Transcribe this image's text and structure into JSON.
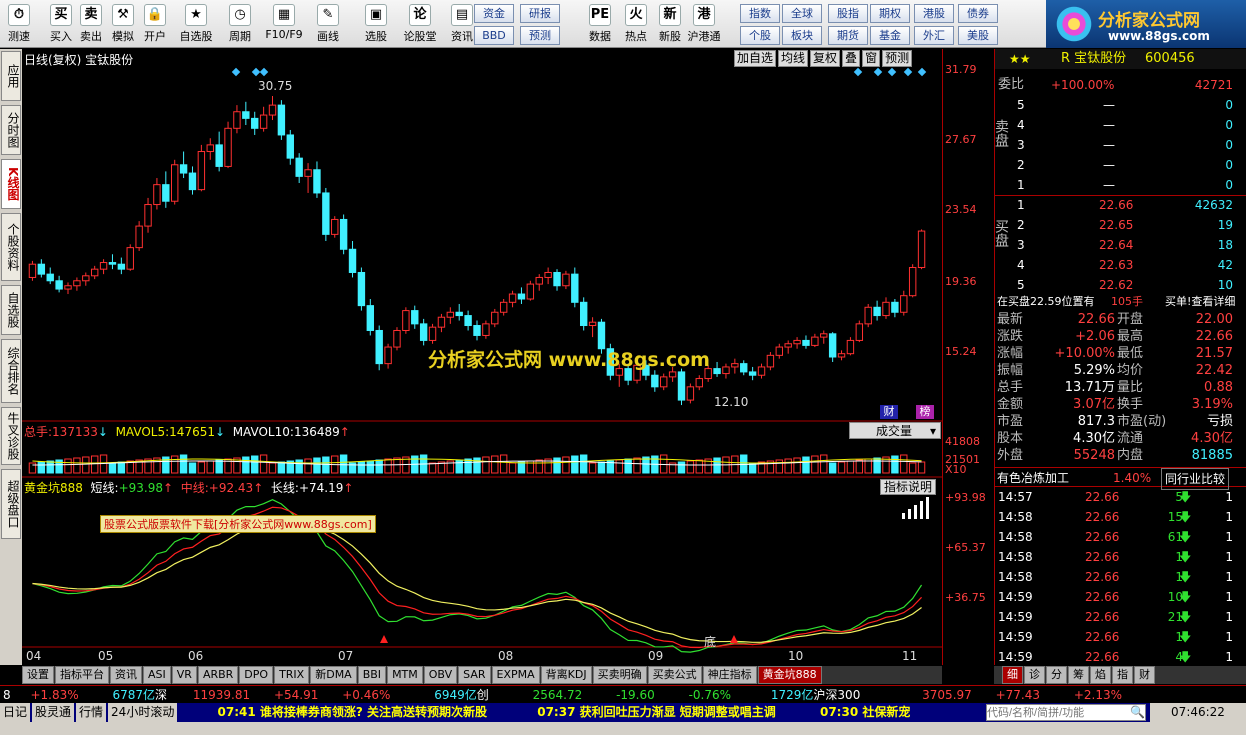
{
  "toolbar": {
    "buttons": [
      {
        "name": "speed-test-button",
        "icon": "clock-icon",
        "glyph": "⏱",
        "label": "测速"
      },
      {
        "name": "buy-button",
        "icon": "buy-icon",
        "glyph": "买",
        "label": "买入"
      },
      {
        "name": "sell-button",
        "icon": "sell-icon",
        "glyph": "卖",
        "label": "卖出"
      },
      {
        "name": "simulate-button",
        "icon": "hammer-icon",
        "glyph": "⚒",
        "label": "模拟"
      },
      {
        "name": "open-account-button",
        "icon": "lock-icon",
        "glyph": "🔒",
        "label": "开户"
      },
      {
        "name": "watchlist-button",
        "icon": "star-icon",
        "glyph": "★",
        "label": "自选股"
      },
      {
        "name": "period-button",
        "icon": "clock-icon",
        "glyph": "◷",
        "label": "周期"
      },
      {
        "name": "f10-button",
        "icon": "grid-icon",
        "glyph": "▦",
        "label": "F10/F9"
      },
      {
        "name": "drawing-button",
        "icon": "pen-icon",
        "glyph": "✎",
        "label": "画线"
      },
      {
        "name": "stock-select-button",
        "icon": "monitor-icon",
        "glyph": "▣",
        "label": "选股"
      },
      {
        "name": "forum-button",
        "icon": "forum-icon",
        "glyph": "论",
        "label": "论股堂"
      },
      {
        "name": "news-button",
        "icon": "document-icon",
        "glyph": "▤",
        "label": "资讯"
      },
      {
        "name": "data-button",
        "icon": "pe-icon",
        "glyph": "PE",
        "label": "数据"
      },
      {
        "name": "hotspot-button",
        "icon": "flame-icon",
        "glyph": "火",
        "label": "热点"
      },
      {
        "name": "new-stock-button",
        "icon": "new-icon",
        "glyph": "新",
        "label": "新股"
      },
      {
        "name": "hk-connect-button",
        "icon": "sh-hk-icon",
        "glyph": "港",
        "label": "沪港通"
      }
    ],
    "square_buttons": [
      [
        "资金",
        "研报"
      ],
      [
        "BBD",
        "预测"
      ],
      [
        "指数",
        "全球"
      ],
      [
        "个股",
        "板块"
      ],
      [
        "股指",
        "期权"
      ],
      [
        "期货",
        "基金"
      ],
      [
        "港股",
        "债券"
      ],
      [
        "外汇",
        "美股"
      ]
    ],
    "logo": {
      "title": "分析家公式网",
      "url": "www.88gs.com"
    }
  },
  "left_tabs": [
    "应用",
    "分时图",
    "K线图",
    "个股资料",
    "自选股",
    "综合排名",
    "牛叉诊股",
    "超级盘口"
  ],
  "chart": {
    "title": "日线(复权) 宝钛股份",
    "controls": [
      "加自选",
      "均线",
      "复权",
      "叠",
      "窗",
      "预测"
    ],
    "price_axis": [
      "31.79",
      "27.67",
      "23.54",
      "19.36",
      "15.24"
    ],
    "high_label": "30.75",
    "low_label": "12.10",
    "watermark": "分析家公式网   www.88gs.com",
    "volume": {
      "total_label": "总手:",
      "total": "137133",
      "mavol5_label": "MAVOL5:",
      "mavol5": "147651",
      "mavol10_label": "MAVOL10:",
      "mavol10": "136489",
      "dropdown": "成交量",
      "axis": [
        "41808",
        "21501",
        "X10"
      ]
    },
    "indicator": {
      "name": "黄金坑888",
      "short_label": "短线:",
      "short": "+93.98",
      "mid_label": "中线:",
      "mid": "+92.43",
      "long_label": "长线:",
      "long": "+74.19",
      "help": "指标说明",
      "axis": [
        "+93.98",
        "+65.37",
        "+36.75"
      ],
      "ad": "股票公式版票软件下载[分析家公式网www.88gs.com]",
      "bottom_label": "底"
    },
    "months": [
      "04",
      "05",
      "06",
      "07",
      "08",
      "09",
      "10",
      "11"
    ],
    "badges": [
      "财",
      "榜"
    ]
  },
  "chart_data": {
    "type": "candlestick",
    "title": "日线(复权) 宝钛股份",
    "y_range": [
      11.5,
      32.5
    ],
    "candles": [
      [
        19.8,
        20.8,
        19.6,
        20.6
      ],
      [
        20.6,
        20.9,
        19.8,
        20.0
      ],
      [
        20.0,
        20.4,
        19.4,
        19.6
      ],
      [
        19.6,
        19.9,
        18.9,
        19.1
      ],
      [
        19.1,
        19.5,
        18.8,
        19.3
      ],
      [
        19.3,
        19.8,
        19.0,
        19.6
      ],
      [
        19.6,
        20.1,
        19.3,
        19.9
      ],
      [
        19.9,
        20.5,
        19.7,
        20.3
      ],
      [
        20.3,
        20.9,
        20.0,
        20.7
      ],
      [
        20.7,
        21.2,
        20.3,
        20.6
      ],
      [
        20.6,
        21.0,
        20.0,
        20.3
      ],
      [
        20.3,
        21.8,
        20.2,
        21.6
      ],
      [
        21.6,
        23.2,
        21.4,
        22.9
      ],
      [
        22.9,
        24.6,
        22.5,
        24.2
      ],
      [
        24.2,
        25.8,
        23.9,
        25.4
      ],
      [
        25.4,
        26.2,
        24.0,
        24.4
      ],
      [
        24.4,
        26.9,
        24.2,
        26.6
      ],
      [
        26.6,
        27.4,
        25.8,
        26.1
      ],
      [
        26.1,
        26.5,
        24.8,
        25.1
      ],
      [
        25.1,
        27.8,
        25.0,
        27.4
      ],
      [
        27.4,
        28.2,
        26.9,
        27.8
      ],
      [
        27.8,
        28.6,
        26.2,
        26.5
      ],
      [
        26.5,
        29.2,
        26.4,
        28.8
      ],
      [
        28.8,
        30.2,
        28.5,
        29.8
      ],
      [
        29.8,
        30.4,
        29.0,
        29.4
      ],
      [
        29.4,
        29.8,
        28.4,
        28.8
      ],
      [
        28.8,
        30.1,
        28.6,
        29.6
      ],
      [
        29.6,
        30.75,
        29.3,
        30.2
      ],
      [
        30.2,
        30.5,
        28.1,
        28.4
      ],
      [
        28.4,
        28.7,
        26.6,
        27.0
      ],
      [
        27.0,
        27.3,
        25.5,
        25.9
      ],
      [
        25.9,
        26.7,
        24.9,
        26.3
      ],
      [
        26.3,
        26.8,
        24.6,
        24.9
      ],
      [
        24.9,
        25.2,
        22.0,
        22.4
      ],
      [
        22.4,
        23.5,
        22.2,
        23.3
      ],
      [
        23.3,
        23.6,
        21.2,
        21.5
      ],
      [
        21.5,
        22.0,
        19.8,
        20.1
      ],
      [
        20.1,
        20.4,
        17.8,
        18.1
      ],
      [
        18.1,
        18.5,
        16.3,
        16.6
      ],
      [
        16.6,
        16.9,
        14.2,
        14.6
      ],
      [
        14.6,
        15.8,
        14.3,
        15.6
      ],
      [
        15.6,
        16.8,
        15.4,
        16.6
      ],
      [
        16.6,
        18.0,
        16.4,
        17.8
      ],
      [
        17.8,
        18.1,
        16.7,
        17.0
      ],
      [
        17.0,
        17.3,
        15.7,
        16.0
      ],
      [
        16.0,
        17.0,
        15.8,
        16.8
      ],
      [
        16.8,
        17.6,
        16.5,
        17.4
      ],
      [
        17.4,
        18.0,
        17.0,
        17.7
      ],
      [
        17.7,
        18.2,
        17.2,
        17.5
      ],
      [
        17.5,
        17.8,
        16.6,
        16.9
      ],
      [
        16.9,
        17.2,
        16.0,
        16.3
      ],
      [
        16.3,
        17.2,
        16.1,
        17.0
      ],
      [
        17.0,
        17.9,
        16.8,
        17.7
      ],
      [
        17.7,
        18.5,
        17.5,
        18.3
      ],
      [
        18.3,
        19.0,
        18.0,
        18.8
      ],
      [
        18.8,
        19.2,
        18.2,
        18.5
      ],
      [
        18.5,
        19.6,
        18.4,
        19.4
      ],
      [
        19.4,
        20.0,
        19.0,
        19.8
      ],
      [
        19.8,
        20.4,
        19.4,
        20.1
      ],
      [
        20.1,
        20.3,
        19.0,
        19.3
      ],
      [
        19.3,
        20.2,
        19.1,
        20.0
      ],
      [
        20.0,
        20.4,
        18.0,
        18.3
      ],
      [
        18.3,
        18.6,
        16.6,
        16.9
      ],
      [
        16.9,
        17.4,
        16.2,
        17.1
      ],
      [
        17.1,
        17.3,
        15.2,
        15.5
      ],
      [
        15.5,
        15.8,
        13.6,
        13.9
      ],
      [
        13.9,
        14.6,
        13.2,
        14.3
      ],
      [
        14.3,
        14.6,
        13.3,
        13.6
      ],
      [
        13.6,
        14.8,
        13.4,
        14.5
      ],
      [
        14.5,
        14.8,
        13.6,
        13.9
      ],
      [
        13.9,
        14.2,
        12.9,
        13.2
      ],
      [
        13.2,
        14.0,
        13.0,
        13.8
      ],
      [
        13.8,
        14.4,
        13.5,
        14.1
      ],
      [
        14.1,
        14.3,
        12.1,
        12.4
      ],
      [
        12.4,
        13.4,
        12.2,
        13.2
      ],
      [
        13.2,
        13.9,
        13.0,
        13.7
      ],
      [
        13.7,
        14.5,
        13.5,
        14.3
      ],
      [
        14.3,
        14.7,
        13.8,
        14.0
      ],
      [
        14.0,
        14.6,
        13.7,
        14.4
      ],
      [
        14.4,
        14.9,
        14.0,
        14.6
      ],
      [
        14.6,
        14.8,
        13.9,
        14.1
      ],
      [
        14.1,
        14.4,
        13.6,
        13.9
      ],
      [
        13.9,
        14.6,
        13.7,
        14.4
      ],
      [
        14.4,
        15.3,
        14.2,
        15.1
      ],
      [
        15.1,
        15.8,
        14.9,
        15.6
      ],
      [
        15.6,
        16.0,
        15.2,
        15.8
      ],
      [
        15.8,
        16.2,
        15.5,
        16.0
      ],
      [
        16.0,
        16.3,
        15.5,
        15.7
      ],
      [
        15.7,
        16.4,
        15.6,
        16.2
      ],
      [
        16.2,
        16.6,
        15.8,
        16.4
      ],
      [
        16.4,
        16.5,
        14.7,
        15.0
      ],
      [
        15.0,
        15.4,
        14.8,
        15.2
      ],
      [
        15.2,
        16.2,
        15.1,
        16.0
      ],
      [
        16.0,
        17.2,
        15.9,
        17.0
      ],
      [
        17.0,
        18.2,
        16.8,
        18.0
      ],
      [
        18.0,
        18.4,
        17.2,
        17.5
      ],
      [
        17.5,
        18.6,
        17.3,
        18.3
      ],
      [
        18.3,
        18.5,
        17.4,
        17.7
      ],
      [
        17.7,
        19.0,
        17.5,
        18.7
      ],
      [
        18.7,
        20.6,
        18.6,
        20.4
      ],
      [
        20.4,
        22.7,
        20.3,
        22.6
      ]
    ],
    "volume_ylim": [
      0,
      41808
    ],
    "indicator_lines": {
      "short_final": 93.98,
      "mid_final": 92.43,
      "long_final": 74.19
    },
    "months": [
      "04",
      "05",
      "06",
      "07",
      "08",
      "09",
      "10",
      "11"
    ]
  },
  "quote": {
    "name": "R 宝钛股份",
    "code": "600456",
    "wei_bi_label": "委比",
    "wei_bi": "+100.00%",
    "wei_cha": "42721",
    "sell_label": "卖盘",
    "buy_label": "买盘",
    "sells": [
      [
        "5",
        "—",
        "0"
      ],
      [
        "4",
        "—",
        "0"
      ],
      [
        "3",
        "—",
        "0"
      ],
      [
        "2",
        "—",
        "0"
      ],
      [
        "1",
        "—",
        "0"
      ]
    ],
    "buys": [
      [
        "1",
        "22.66",
        "42632"
      ],
      [
        "2",
        "22.65",
        "19"
      ],
      [
        "3",
        "22.64",
        "18"
      ],
      [
        "4",
        "22.63",
        "42"
      ],
      [
        "5",
        "22.62",
        "10"
      ]
    ],
    "info_line": "在买盘22.59位置有",
    "info_qty": "105手",
    "info_link": "买单!查看详细",
    "stats": [
      [
        "最新",
        "22.66",
        "开盘",
        "22.00"
      ],
      [
        "涨跌",
        "+2.06",
        "最高",
        "22.66"
      ],
      [
        "涨幅",
        "+10.00%",
        "最低",
        "21.57"
      ],
      [
        "振幅",
        "5.29%",
        "均价",
        "22.42"
      ],
      [
        "总手",
        "13.71万",
        "量比",
        "0.88"
      ],
      [
        "金额",
        "3.07亿",
        "换手",
        "3.19%"
      ],
      [
        "市盈",
        "817.3",
        "市盈(动)",
        "亏损"
      ],
      [
        "股本",
        "4.30亿",
        "流通",
        "4.30亿"
      ],
      [
        "外盘",
        "55248",
        "内盘",
        "81885"
      ]
    ],
    "sector": "有色冶炼加工",
    "sector_pct": "1.40%",
    "sector_btn": "同行业比较",
    "ticks": [
      [
        "14:57",
        "22.66",
        "5",
        "1"
      ],
      [
        "14:58",
        "22.66",
        "15",
        "1"
      ],
      [
        "14:58",
        "22.66",
        "61",
        "1"
      ],
      [
        "14:58",
        "22.66",
        "1",
        "1"
      ],
      [
        "14:58",
        "22.66",
        "1",
        "1"
      ],
      [
        "14:59",
        "22.66",
        "10",
        "1"
      ],
      [
        "14:59",
        "22.66",
        "21",
        "1"
      ],
      [
        "14:59",
        "22.66",
        "1",
        "1"
      ],
      [
        "14:59",
        "22.66",
        "4",
        "1"
      ],
      [
        "14:59",
        "22.66",
        "4",
        "1"
      ]
    ],
    "right_tabs": [
      "细",
      "诊",
      "分",
      "筹",
      "焰",
      "指",
      "财"
    ]
  },
  "bottom_tabs": [
    "设置",
    "指标平台",
    "资讯",
    "ASI",
    "VR",
    "ARBR",
    "DPO",
    "TRIX",
    "新DMA",
    "BBI",
    "MTM",
    "OBV",
    "SAR",
    "EXPMA",
    "背离KDJ",
    "买卖明确",
    "买卖公式",
    "神庄指标",
    "黄金坑888"
  ],
  "status": {
    "s1": "8",
    "s2": "+1.83%",
    "s3": "6787亿",
    "s4": "深",
    "s5": "11939.81",
    "s6": "+54.91",
    "s7": "+0.46%",
    "s8": "6949亿",
    "s9": "创",
    "s10": "2564.72",
    "s11": "-19.60",
    "s12": "-0.76%",
    "s13": "1729亿",
    "s14": "沪深300",
    "s15": "3705.97",
    "s16": "+77.43",
    "s17": "+2.13%"
  },
  "news": {
    "b1": "日记",
    "b2": "股灵通",
    "b3": "行情",
    "b4": "24小时滚动",
    "n1": "07:41 谁将接棒券商领涨? 关注高送转预期次新股",
    "n2": "07:37 获利回吐压力渐显 短期调整或唱主调",
    "n3": "07:30 社保新宠",
    "search_placeholder": "代码/名称/简拼/功能",
    "clock": "07:46:22"
  }
}
